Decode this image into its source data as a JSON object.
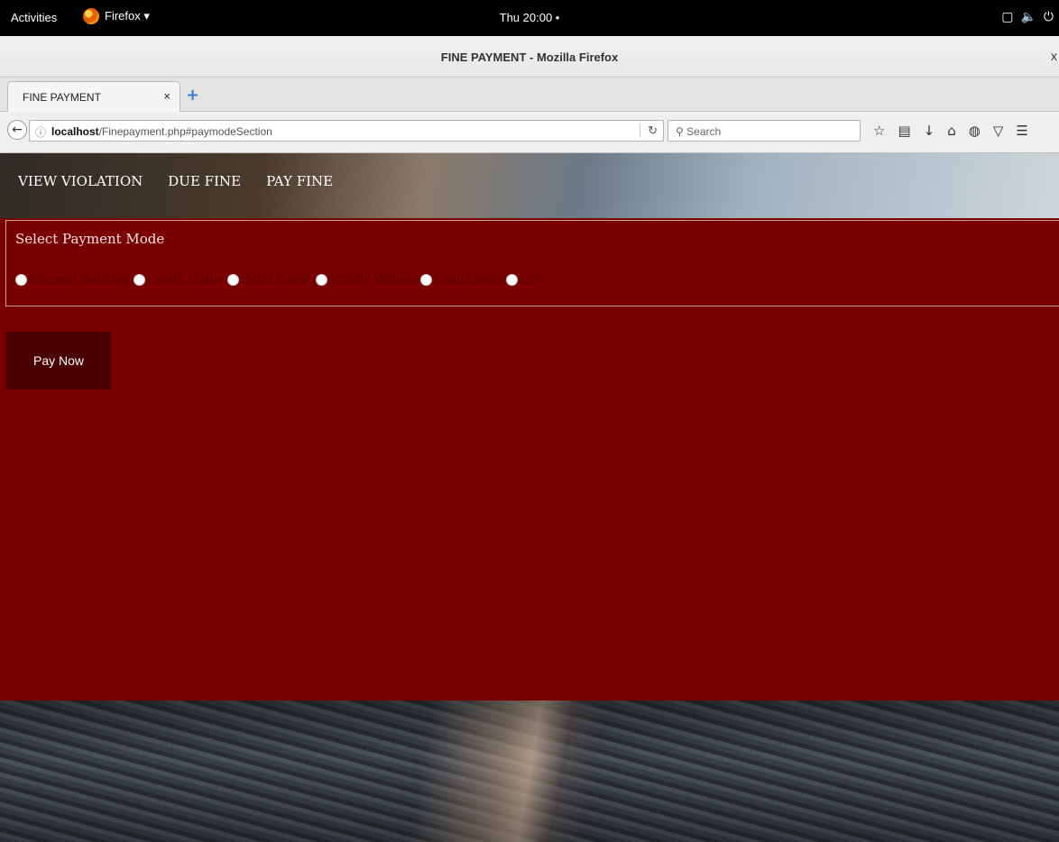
{
  "system_bar": {
    "activities": "Activities",
    "app_name": "Firefox ▾",
    "clock": "Thu 20:00 •",
    "tray_icons": [
      "window-icon",
      "volume-icon",
      "power-icon"
    ]
  },
  "window": {
    "title": "FINE PAYMENT - Mozilla Firefox",
    "close": "x"
  },
  "tab": {
    "label": "FINE PAYMENT",
    "close": "×",
    "new_tab": "+"
  },
  "navbar": {
    "url_host": "localhost",
    "url_path": "/Finepayment.php#paymodeSection",
    "search_placeholder": "Search",
    "toolbar_icons": [
      "bookmark-star-icon",
      "reading-list-icon",
      "download-icon",
      "home-icon",
      "chat-icon",
      "pocket-icon",
      "menu-icon"
    ]
  },
  "site_menu": {
    "items": [
      "VIEW VIOLATION",
      "DUE FINE",
      "PAY FINE"
    ]
  },
  "payment": {
    "heading": "Select Payment Mode",
    "options": [
      "Internet Banking",
      "Credit Cards",
      "Debit Cards",
      "Mobile Wallets",
      "Cash Cards",
      "UPI"
    ],
    "pay_button": "Pay Now"
  },
  "colors": {
    "panel_red": "#7a0000",
    "button_dark": "#4a0000",
    "option_text": "#5a0000"
  }
}
